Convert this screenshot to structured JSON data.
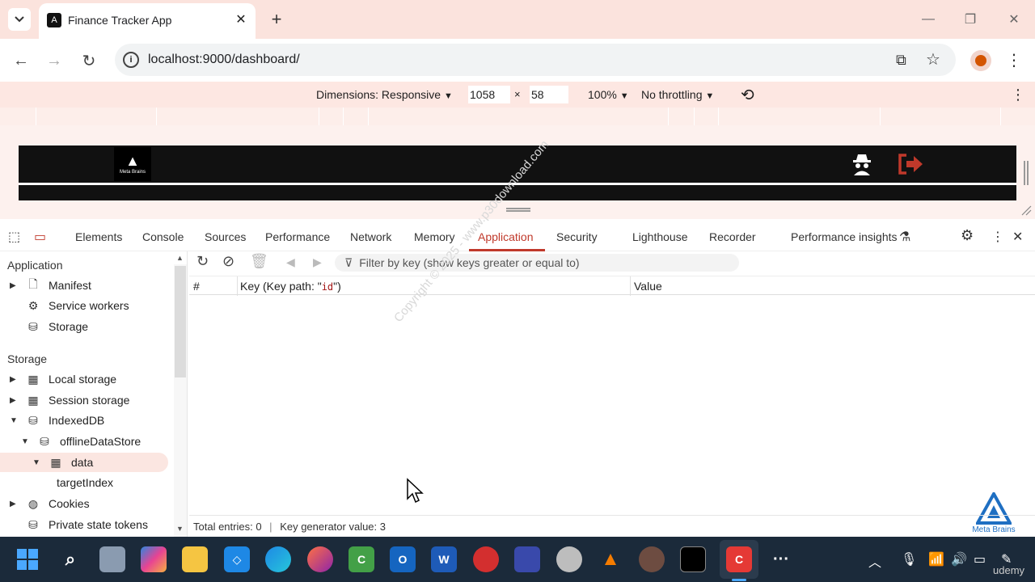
{
  "browser": {
    "tab_title": "Finance Tracker App",
    "tab_favicon_glyph": "A",
    "new_tab_glyph": "+",
    "url": "localhost:9000/dashboard/"
  },
  "device_toolbar": {
    "dimensions_label": "Dimensions: Responsive",
    "width": "1058",
    "height": "58",
    "times": "×",
    "zoom": "100%",
    "throttling": "No throttling"
  },
  "app": {
    "logo_text": "Meta Brains",
    "spy_icon": "incognito-spy-icon",
    "logout_icon": "logout-icon",
    "logout_color": "#c0392b"
  },
  "devtools": {
    "tabs": [
      "Elements",
      "Console",
      "Sources",
      "Performance",
      "Network",
      "Memory",
      "Application",
      "Security",
      "Lighthouse",
      "Recorder",
      "Performance insights"
    ],
    "active_tab": "Application",
    "accent_color": "#c0392b"
  },
  "sidebar": {
    "application_heading": "Application",
    "application_items": [
      "Manifest",
      "Service workers",
      "Storage"
    ],
    "storage_heading": "Storage",
    "storage_items": [
      "Local storage",
      "Session storage",
      "IndexedDB",
      "offlineDataStore",
      "data",
      "targetIndex",
      "Cookies",
      "Private state tokens"
    ]
  },
  "main": {
    "filter_placeholder": "Filter by key (show keys greater or equal to)",
    "col_index": "#",
    "col_key_prefix": "Key (Key path: \"",
    "col_key_path": "id",
    "col_key_suffix": "\")",
    "col_value": "Value",
    "status_total": "Total entries: 0",
    "status_sep": "|",
    "status_keygen": "Key generator value: 3",
    "watermark": "Copyright © 2025 - www.p30download.com"
  },
  "watermark_brand": "Meta Brains",
  "taskbar_udemy": "udemy"
}
